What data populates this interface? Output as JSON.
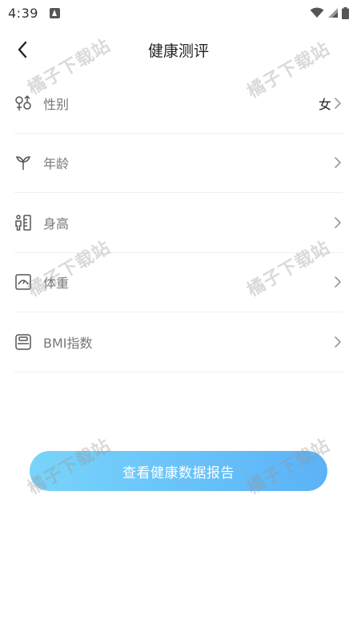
{
  "status_bar": {
    "time": "4:39"
  },
  "header": {
    "title": "健康测评"
  },
  "items": [
    {
      "label": "性别",
      "value": "女"
    },
    {
      "label": "年龄",
      "value": ""
    },
    {
      "label": "身高",
      "value": ""
    },
    {
      "label": "体重",
      "value": ""
    },
    {
      "label": "BMI指数",
      "value": ""
    }
  ],
  "cta": {
    "label": "查看健康数据报告"
  },
  "watermark": "橘子下载站",
  "colors": {
    "accent_start": "#79d4fa",
    "accent_end": "#5bb2f7"
  }
}
